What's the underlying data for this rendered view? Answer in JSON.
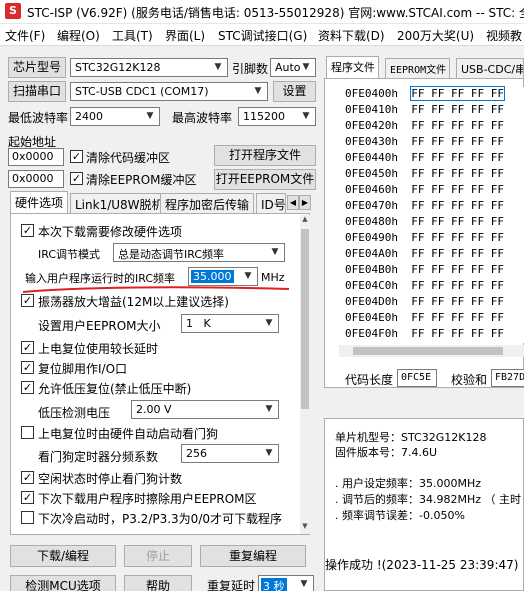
{
  "window": {
    "title": "STC-ISP (V6.92F) (服务电话/销售电话: 0513-55012928) 官网:www.STCAI.com  -- STC: 全"
  },
  "menu": [
    "文件(F)",
    "编程(O)",
    "工具(T)",
    "界面(L)",
    "STC调试接口(G)",
    "资料下载(D)",
    "200万大奖(U)",
    "视频教"
  ],
  "chip": {
    "label": "芯片型号",
    "value": "STC32G12K128",
    "pin_label": "引脚数",
    "pin_value": "Auto"
  },
  "port": {
    "scan_button": "扫描串口",
    "value": "STC-USB CDC1 (COM17)",
    "settings_button": "设置"
  },
  "baud": {
    "min_label": "最低波特率",
    "min_value": "2400",
    "max_label": "最高波特率",
    "max_value": "115200"
  },
  "start_addr": {
    "label": "起始地址",
    "code_addr": "0x0000",
    "clear_code_label": "清除代码缓冲区",
    "eeprom_addr": "0x0000",
    "clear_eeprom_label": "清除EEPROM缓冲区",
    "open_program_button": "打开程序文件",
    "open_eeprom_button": "打开EEPROM文件"
  },
  "left_tabs": [
    "硬件选项",
    "Link1/U8W脱机",
    "程序加密后传输",
    "ID号"
  ],
  "hw": {
    "opt1": "本次下载需要修改硬件选项",
    "irc_mode_label": "IRC调节模式",
    "irc_mode_value": "总是动态调节IRC频率",
    "freq_label": "输入用户程序运行时的IRC频率",
    "freq_value": "35.000",
    "freq_unit": "MHz",
    "opt_osc": "振荡器放大增益(12M以上建议选择)",
    "eeprom_size_label": "设置用户EEPROM大小",
    "eeprom_size_value": "1   K",
    "opt_delay": "上电复位使用较长延时",
    "opt_reset_io": "复位脚用作I/O口",
    "opt_lvr": "允许低压复位(禁止低压中断)",
    "lvd_label": "低压检测电压",
    "lvd_value": "2.00 V",
    "opt_wdt": "上电复位时由硬件自动启动看门狗",
    "wdt_div_label": "看门狗定时器分频系数",
    "wdt_div_value": "256",
    "opt_idle_wdt": "空闲状态时停止看门狗计数",
    "opt_erase_eeprom": "下次下载用户程序时擦除用户EEPROM区",
    "opt_cold": "下次冷启动时，P3.2/P3.3为0/0才可下载程序"
  },
  "buttons": {
    "download": "下载/编程",
    "stop": "停止",
    "reprogram": "重复编程",
    "detect": "检测MCU选项",
    "help": "帮助",
    "repeat_delay_label": "重复延时",
    "repeat_delay_value": "3 秒"
  },
  "right_tabs": [
    "程序文件",
    "EEPROM文件",
    "USB-CDC/串"
  ],
  "hex": {
    "rows": [
      {
        "addr": "0FE0400h",
        "bytes": "FF FF FF FF FF"
      },
      {
        "addr": "0FE0410h",
        "bytes": "FF FF FF FF FF"
      },
      {
        "addr": "0FE0420h",
        "bytes": "FF FF FF FF FF"
      },
      {
        "addr": "0FE0430h",
        "bytes": "FF FF FF FF FF"
      },
      {
        "addr": "0FE0440h",
        "bytes": "FF FF FF FF FF"
      },
      {
        "addr": "0FE0450h",
        "bytes": "FF FF FF FF FF"
      },
      {
        "addr": "0FE0460h",
        "bytes": "FF FF FF FF FF"
      },
      {
        "addr": "0FE0470h",
        "bytes": "FF FF FF FF FF"
      },
      {
        "addr": "0FE0480h",
        "bytes": "FF FF FF FF FF"
      },
      {
        "addr": "0FE0490h",
        "bytes": "FF FF FF FF FF"
      },
      {
        "addr": "0FE04A0h",
        "bytes": "FF FF FF FF FF"
      },
      {
        "addr": "0FE04B0h",
        "bytes": "FF FF FF FF FF"
      },
      {
        "addr": "0FE04C0h",
        "bytes": "FF FF FF FF FF"
      },
      {
        "addr": "0FE04D0h",
        "bytes": "FF FF FF FF FF"
      },
      {
        "addr": "0FE04E0h",
        "bytes": "FF FF FF FF FF"
      },
      {
        "addr": "0FE04F0h",
        "bytes": "FF FF FF FF FF"
      }
    ],
    "code_len_label": "代码长度",
    "code_len_value": "0FC5E",
    "checksum_label": "校验和",
    "checksum_value": "FB27D"
  },
  "info": {
    "chip": "单片机型号：STC32G12K128",
    "firmware": "固件版本号：7.4.6U",
    "user_freq": ". 用户设定频率：35.000MHz",
    "adjusted_freq": ". 调节后的频率：34.982MHz （ 主时",
    "freq_error": ". 频率调节误差：-0.050%",
    "result": "操作成功 !(2023-11-25 23:39:47)"
  },
  "colors": {
    "highlight": "#0078d7",
    "annotation": "#e02020"
  }
}
